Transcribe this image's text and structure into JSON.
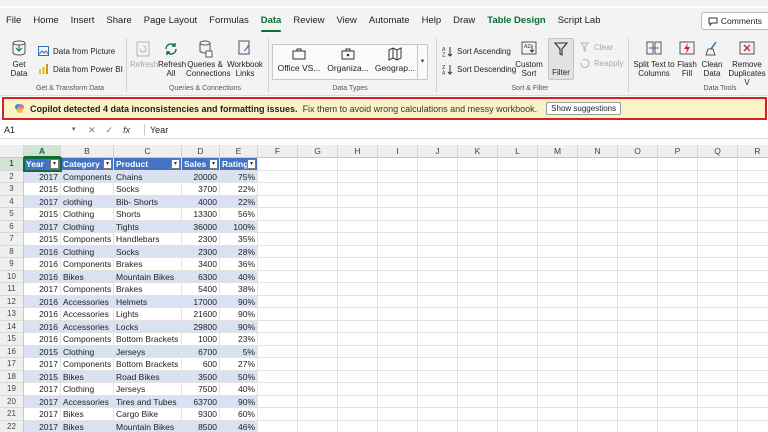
{
  "menu": {
    "tabs": [
      "File",
      "Home",
      "Insert",
      "Share",
      "Page Layout",
      "Formulas",
      "Data",
      "Review",
      "View",
      "Automate",
      "Help",
      "Draw",
      "Table Design",
      "Script Lab"
    ],
    "active": "Data",
    "comments_label": "Comments"
  },
  "ribbon": {
    "get_data": "Get Data",
    "data_from_picture": "Data from Picture",
    "data_from_powerbi": "Data from Power BI",
    "refresh": "Refresh",
    "refresh_all": "Refresh All",
    "queries_connections": "Queries & Connections",
    "workbook_links": "Workbook Links",
    "group_get_transform": "Get & Transform Data",
    "group_queries": "Queries & Connections",
    "datatype_stocks": "Office VS...",
    "datatype_org": "Organiza...",
    "datatype_geo": "Geograp...",
    "group_data_types": "Data Types",
    "sort_ascending": "Sort Ascending",
    "sort_descending": "Sort Descending",
    "custom_sort": "Custom Sort",
    "filter": "Filter",
    "clear": "Clear",
    "reapply": "Reapply",
    "group_sort_filter": "Sort & Filter",
    "split_text": "Split Text to Columns",
    "flash_fill": "Flash Fill",
    "clean_data": "Clean Data",
    "remove_duplicates": "Remove Duplicates V",
    "group_data_tools": "Data Tools"
  },
  "banner": {
    "message_bold": "Copilot detected 4 data inconsistencies and formatting issues.",
    "message_detail": "Fix them to avoid wrong calculations and messy workbook.",
    "button": "Show suggestions"
  },
  "formula_bar": {
    "name_box": "A1",
    "fx": "fx",
    "value": "Year"
  },
  "sheet": {
    "columns": [
      "A",
      "B",
      "C",
      "D",
      "E",
      "F",
      "G",
      "H",
      "I",
      "J",
      "K",
      "L",
      "M",
      "N",
      "O",
      "P",
      "Q",
      "R"
    ],
    "headers": [
      "Year",
      "Category",
      "Product",
      "Sales",
      "Rating"
    ],
    "rows": [
      [
        "2017",
        "Components",
        "Chains",
        "20000",
        "75%"
      ],
      [
        "2015",
        "Clothing",
        "Socks",
        "3700",
        "22%"
      ],
      [
        "2017",
        "clothing",
        "Bib-  Shorts",
        "4000",
        "22%"
      ],
      [
        "2015",
        "Clothing",
        "Shorts",
        "13300",
        "56%"
      ],
      [
        "2017",
        "Clothing",
        "Tights",
        "36000",
        "100%"
      ],
      [
        "2015",
        "Components",
        "Handlebars",
        "2300",
        "35%"
      ],
      [
        "2016",
        "Clothing",
        "Socks",
        "2300",
        "28%"
      ],
      [
        "2016",
        "Components",
        "Brakes",
        "3400",
        "36%"
      ],
      [
        "2016",
        "Bikes",
        "Mountain Bikes",
        "6300",
        "40%"
      ],
      [
        "2017",
        "Components",
        "Brakes",
        "5400",
        "38%"
      ],
      [
        "2016",
        "Accessories",
        "Helmets",
        "17000",
        "90%"
      ],
      [
        "2016",
        "Accessories",
        "Lights",
        "21600",
        "90%"
      ],
      [
        "2016",
        "Accessories",
        "Locks",
        "29800",
        "90%"
      ],
      [
        "2016",
        "Components",
        "Bottom Brackets",
        "1000",
        "23%"
      ],
      [
        "2015",
        "Clothing",
        "Jerseys",
        "6700",
        "5%"
      ],
      [
        "2017",
        "Components",
        "Bottom Brackets",
        "600",
        "27%"
      ],
      [
        "2015",
        "Bikes",
        "Road Bikes",
        "3500",
        "50%"
      ],
      [
        "2017",
        "Clothing",
        "Jerseys",
        "7500",
        "40%"
      ],
      [
        "2017",
        "Accessories",
        "Tires and Tubes",
        "63700",
        "90%"
      ],
      [
        "2017",
        "Bikes",
        "Cargo Bike",
        "9300",
        "60%"
      ],
      [
        "2017",
        "Bikes",
        "Mountain Bikes",
        "8500",
        "46%"
      ]
    ]
  },
  "colors": {
    "accent_green": "#0e6c35",
    "table_header": "#4472c4",
    "table_band": "#d9e1f2",
    "banner_bg": "#fbf2c8",
    "banner_border": "#d1232a"
  }
}
